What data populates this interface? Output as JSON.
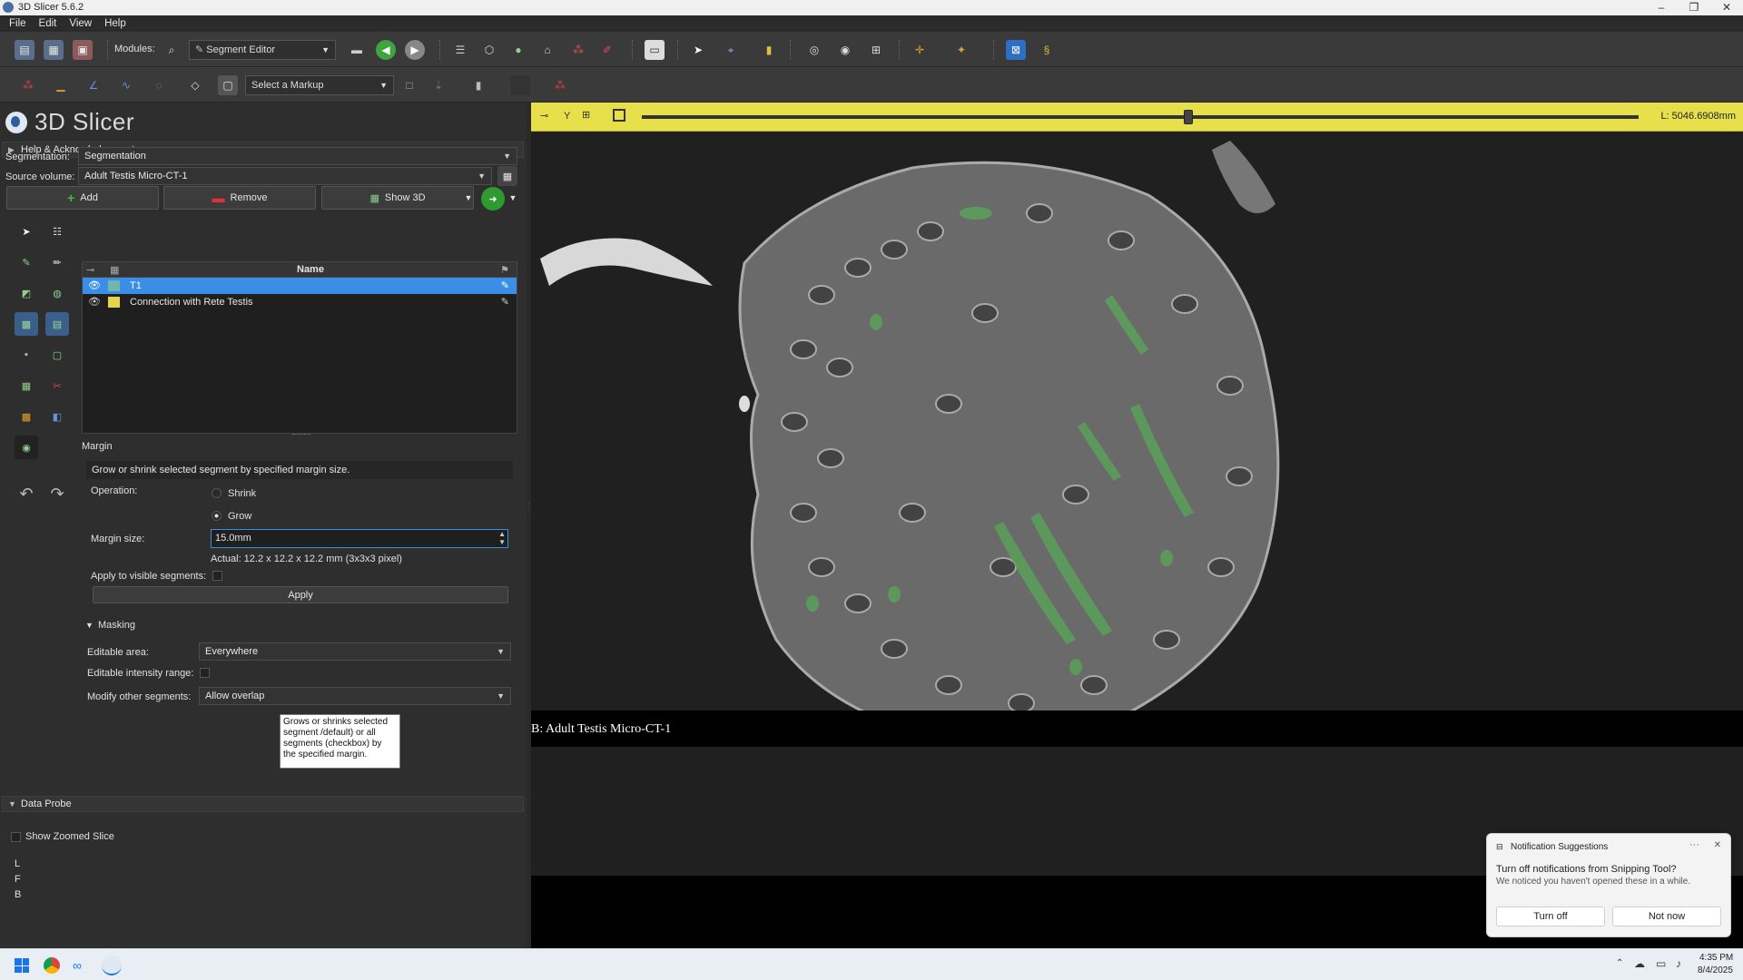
{
  "window": {
    "title": "3D Slicer 5.6.2",
    "minimize": "–",
    "restore": "❐",
    "close": "✕"
  },
  "menu": [
    "File",
    "Edit",
    "View",
    "Help"
  ],
  "toolbar1": {
    "modules_label": "Modules:",
    "module_name": "Segment Editor"
  },
  "toolbar2": {
    "markup_placeholder": "Select a Markup"
  },
  "app_logo": "3D Slicer",
  "help_section": "Help & Acknowledgement",
  "segmentation": {
    "label": "Segmentation:",
    "value": "Segmentation"
  },
  "source_volume": {
    "label": "Source volume:",
    "value": "Adult Testis Micro-CT-1"
  },
  "buttons": {
    "add": "Add",
    "remove": "Remove",
    "show3d": "Show 3D"
  },
  "segment_table": {
    "header_name": "Name",
    "rows": [
      {
        "name": "T1",
        "color": "#6fb7a8",
        "selected": true
      },
      {
        "name": "Connection with Rete Testis",
        "color": "#e8d44a",
        "selected": false
      }
    ]
  },
  "margin": {
    "section": "Margin",
    "description": "Grow or shrink selected segment by specified margin size.",
    "operation_label": "Operation:",
    "shrink": "Shrink",
    "grow": "Grow",
    "size_label": "Margin size:",
    "size_value": "15.0mm",
    "actual": "Actual: 12.2 x 12.2 x 12.2 mm (3x3x3 pixel)",
    "apply_visible_label": "Apply to visible segments:",
    "apply": "Apply"
  },
  "tooltip": "Grows or shrinks selected segment /default) or all segments (checkbox) by the specified margin.",
  "masking": {
    "section": "Masking",
    "editable_area_label": "Editable area:",
    "editable_area_value": "Everywhere",
    "intensity_label": "Editable intensity range:",
    "modify_label": "Modify other segments:",
    "modify_value": "Allow overlap"
  },
  "data_probe": {
    "section": "Data Probe",
    "show_zoomed": "Show Zoomed Slice",
    "lines": [
      "L",
      "F",
      "B"
    ]
  },
  "viewer": {
    "orientation": "Y",
    "slider_fraction": 0.548,
    "offset": "L: 5046.6908mm",
    "corner_label": "B: Adult Testis Micro-CT-1",
    "bar_color": "#e8e04a",
    "segment_color": "#5aa05a"
  },
  "notification": {
    "header": "Notification Suggestions",
    "title": "Turn off notifications from Snipping Tool?",
    "body": "We noticed you haven't opened these in a while.",
    "turn_off": "Turn off",
    "not_now": "Not now",
    "more": "···",
    "close": "✕"
  },
  "taskbar": {
    "time": "4:35 PM",
    "date": "8/4/2025"
  }
}
